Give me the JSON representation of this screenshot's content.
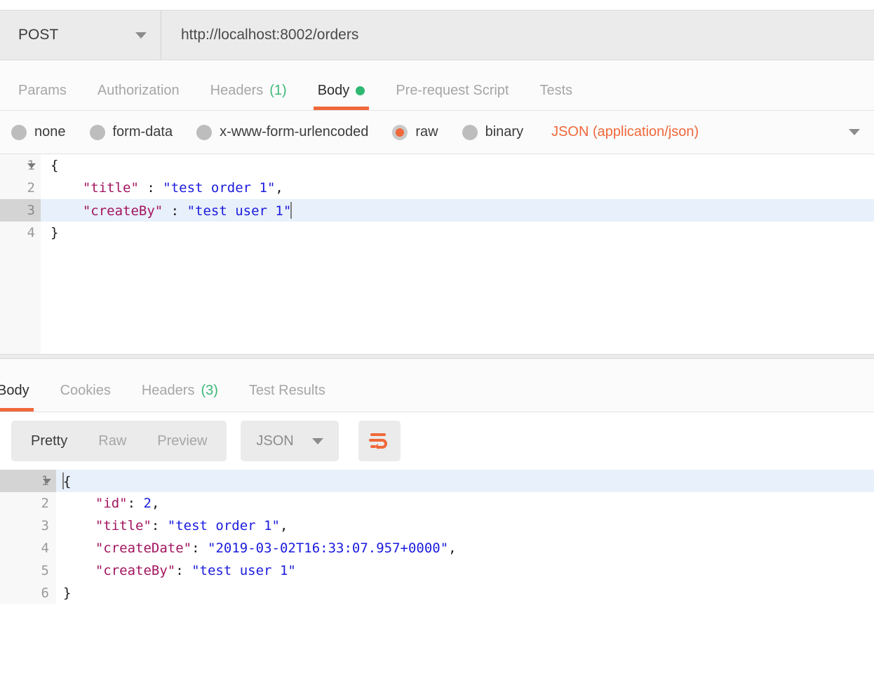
{
  "request": {
    "method": "POST",
    "url": "http://localhost:8002/orders",
    "tabs": [
      {
        "label": "Params",
        "count": "",
        "dot": false,
        "active": false
      },
      {
        "label": "Authorization",
        "count": "",
        "dot": false,
        "active": false
      },
      {
        "label": "Headers",
        "count": "(1)",
        "dot": false,
        "active": false
      },
      {
        "label": "Body",
        "count": "",
        "dot": true,
        "active": true
      },
      {
        "label": "Pre-request Script",
        "count": "",
        "dot": false,
        "active": false
      },
      {
        "label": "Tests",
        "count": "",
        "dot": false,
        "active": false
      }
    ],
    "body_types": [
      {
        "label": "none",
        "checked": false
      },
      {
        "label": "form-data",
        "checked": false
      },
      {
        "label": "x-www-form-urlencoded",
        "checked": false
      },
      {
        "label": "raw",
        "checked": true
      },
      {
        "label": "binary",
        "checked": false
      }
    ],
    "content_type": "JSON (application/json)",
    "body_lines": [
      {
        "num": "1",
        "fold": true,
        "highlight": false,
        "text": "{"
      },
      {
        "num": "2",
        "fold": false,
        "highlight": false,
        "text": "    \"title\" : \"test order 1\","
      },
      {
        "num": "3",
        "fold": false,
        "highlight": true,
        "text": "    \"createBy\" : \"test user 1\""
      },
      {
        "num": "4",
        "fold": false,
        "highlight": false,
        "text": "}"
      }
    ]
  },
  "response": {
    "tabs": [
      {
        "label": "Body",
        "count": "",
        "active": true
      },
      {
        "label": "Cookies",
        "count": "",
        "active": false
      },
      {
        "label": "Headers",
        "count": "(3)",
        "active": false
      },
      {
        "label": "Test Results",
        "count": "",
        "active": false
      }
    ],
    "view_modes": [
      {
        "label": "Pretty",
        "active": true
      },
      {
        "label": "Raw",
        "active": false
      },
      {
        "label": "Preview",
        "active": false
      }
    ],
    "format": "JSON",
    "wrap_icon": "word-wrap-icon",
    "body_lines": [
      {
        "num": "1",
        "fold": true,
        "highlight": true,
        "text": "{"
      },
      {
        "num": "2",
        "fold": false,
        "highlight": false,
        "text": "    \"id\": 2,"
      },
      {
        "num": "3",
        "fold": false,
        "highlight": false,
        "text": "    \"title\": \"test order 1\","
      },
      {
        "num": "4",
        "fold": false,
        "highlight": false,
        "text": "    \"createDate\": \"2019-03-02T16:33:07.957+0000\","
      },
      {
        "num": "5",
        "fold": false,
        "highlight": false,
        "text": "    \"createBy\": \"test user 1\""
      },
      {
        "num": "6",
        "fold": false,
        "highlight": false,
        "text": "}"
      }
    ]
  },
  "colors": {
    "accent": "#f0683a",
    "success": "#2eb872",
    "key": "#a3155f",
    "string": "#1b1bdd",
    "panel": "#ebebeb",
    "line_highlight": "#e8f0fb"
  }
}
